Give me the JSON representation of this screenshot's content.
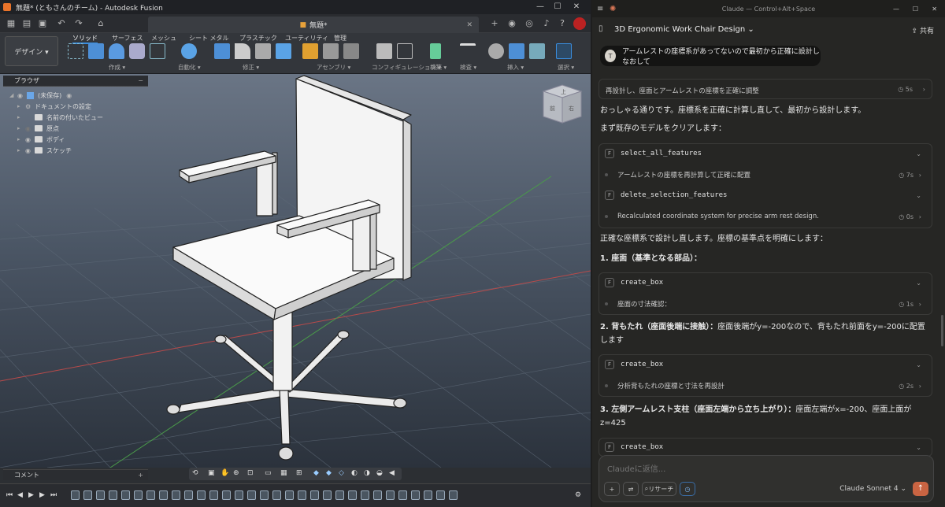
{
  "fusion": {
    "title": "無題* (ともさんのチーム) - Autodesk Fusion",
    "doc_tab": "無題*",
    "design_label": "デザイン ▾",
    "ribbon_tabs": [
      "ソリッド",
      "サーフェス",
      "メッシュ",
      "シート メタル",
      "プラスチック",
      "ユーティリティ",
      "管理"
    ],
    "ribbon_groups": [
      "作成 ▾",
      "自動化 ▾",
      "修正 ▾",
      "アセンブリ ▾",
      "コンフィギュレーション ▾",
      "構築 ▾",
      "検査 ▾",
      "挿入 ▾",
      "選択 ▾"
    ],
    "browser_title": "ブラウザ",
    "tree": [
      "(未保存)",
      "ドキュメントの設定",
      "名前の付いたビュー",
      "原点",
      "ボディ",
      "スケッチ"
    ],
    "comment_label": "コメント",
    "viewcube_labels": [
      "上",
      "前",
      "右"
    ]
  },
  "claude": {
    "window_title": "Claude — Control+Alt+Space",
    "conversation_title": "3D Ergonomic Work Chair Design ⌄",
    "share_label": "共有",
    "user_avatar": "T",
    "user_message": "アームレストの座標系があってないので最初から正確に設計しなおして",
    "step1_label": "再設計し、座面とアームレストの座標を正確に調整",
    "step1_time": "5s",
    "p1": "おっしゃる通りです。座標系を正確に計算し直して、最初から設計します。",
    "p2": "まず既存のモデルをクリアします：",
    "tool_icon": "F",
    "tools_a": [
      {
        "fn": "select_all_features",
        "note": "アームレストの座標を再計算して正確に配置",
        "time": "7s"
      },
      {
        "fn": "delete_selection_features",
        "note": "Recalculated coordinate system for precise arm rest design.",
        "time": "0s"
      }
    ],
    "p3": "正確な座標系で設計し直します。座標の基準点を明確にします：",
    "h1": "1. 座面（基準となる部品）：",
    "tool_b": {
      "fn": "create_box",
      "note": "座面の寸法確認：",
      "time": "1s"
    },
    "h2_bold": "2. 背もたれ（座面後端に接触）：",
    "h2_rest": "座面後端がy=-200なので、背もたれ前面をy=-200に配置します",
    "tool_c": {
      "fn": "create_box",
      "note": "分析背もたれの座標と寸法を再設計",
      "time": "2s"
    },
    "h3_bold": "3. 左側アームレスト支柱（座面左端から立ち上がり）：",
    "h3_rest": "座面左端がx=-200、座面上面がz=425",
    "tool_d": {
      "fn": "create_box"
    },
    "input_placeholder": "Claudeに返信...",
    "research_label": "リサーチ",
    "model_label": "Claude Sonnet 4 ⌄"
  }
}
